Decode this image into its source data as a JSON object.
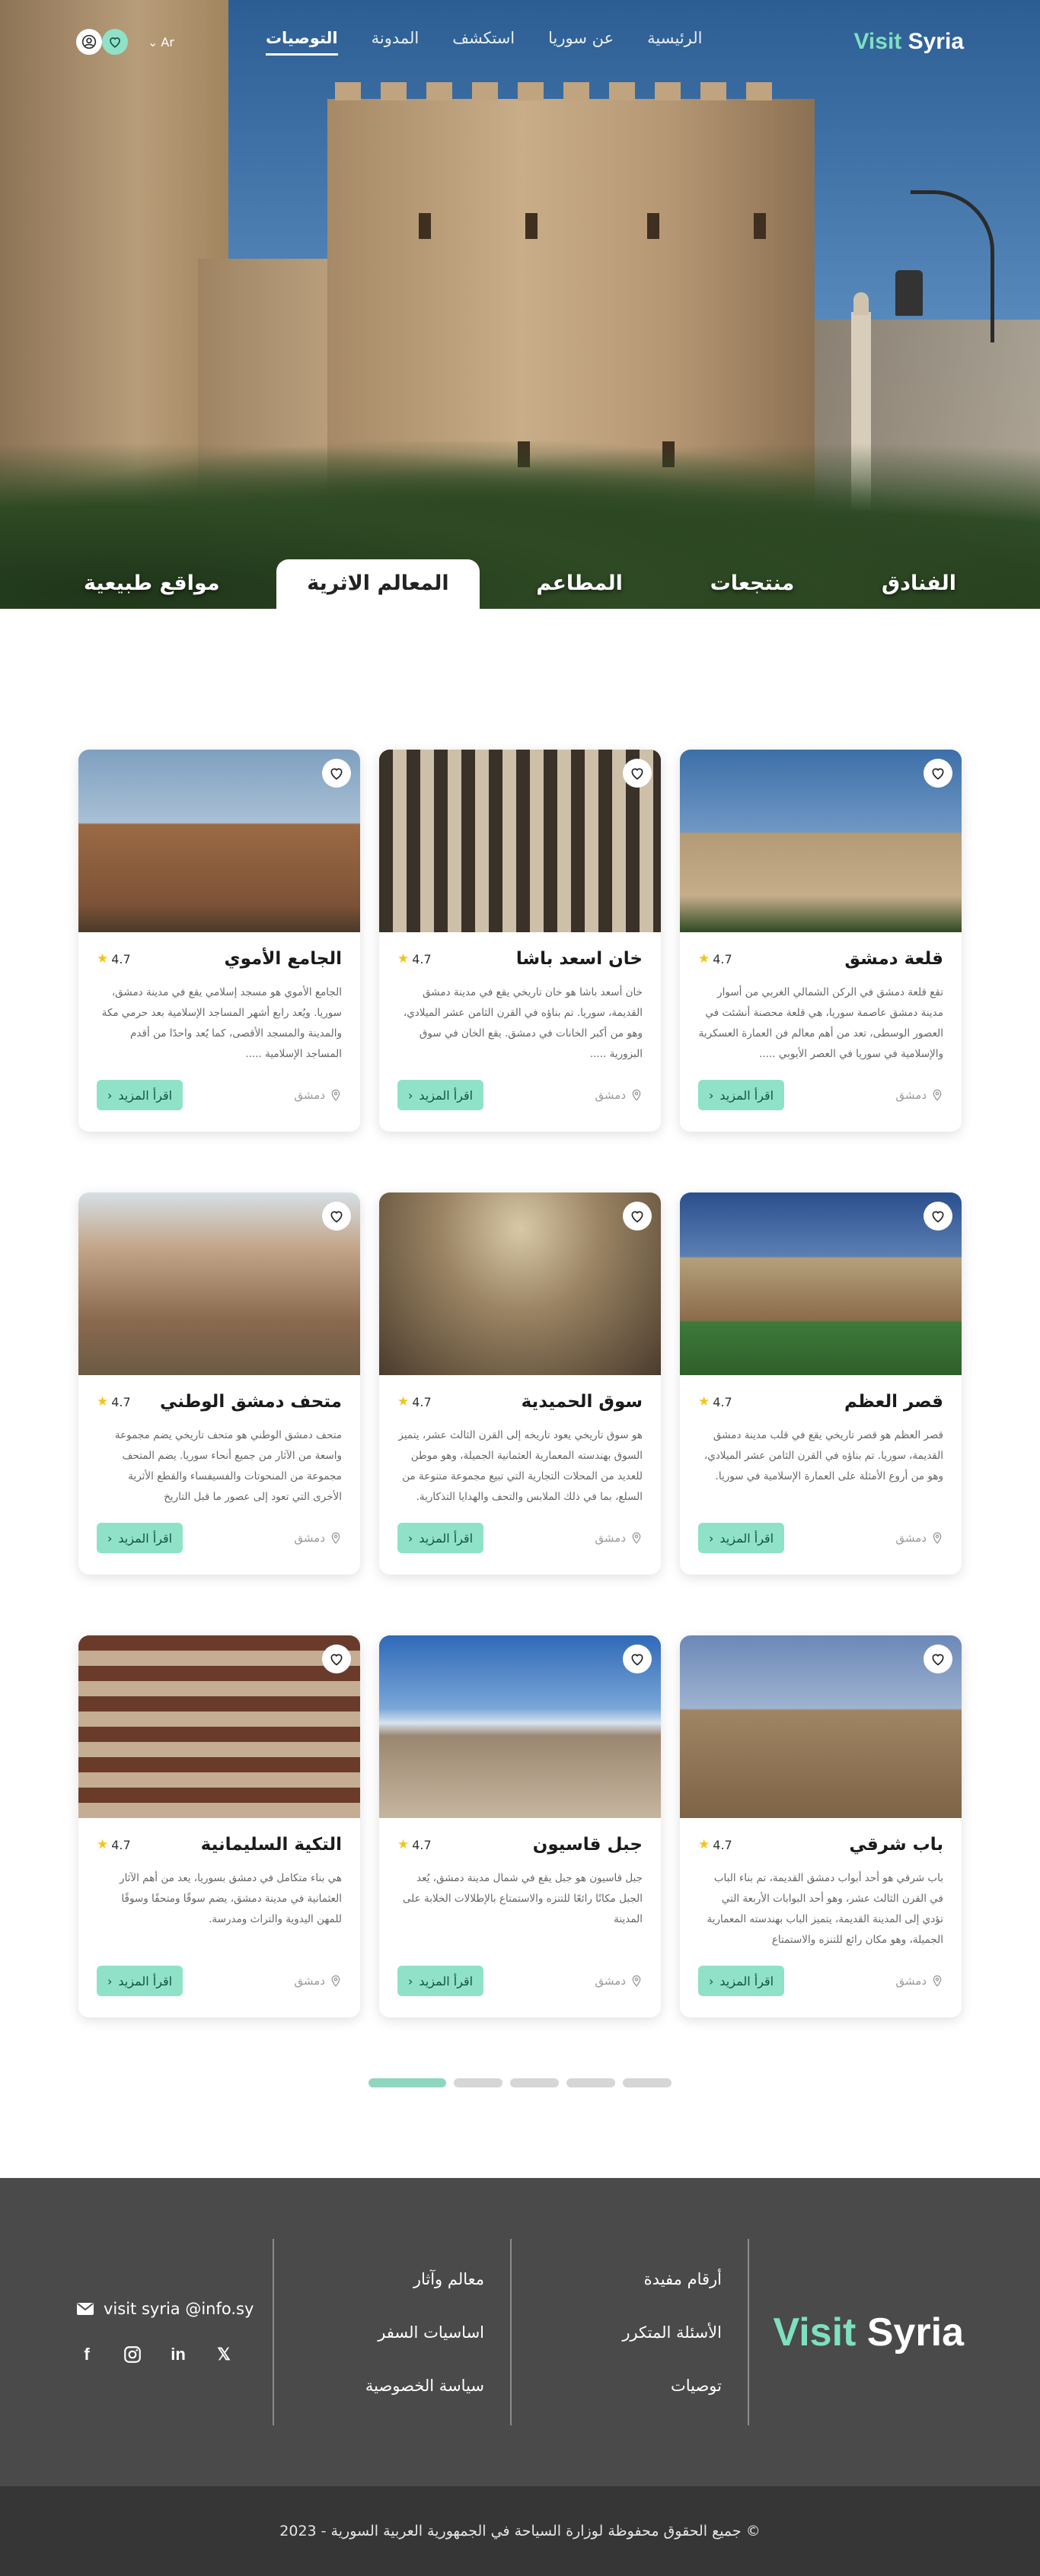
{
  "colors": {
    "accent": "#8fe2c7",
    "accent_dark": "#14523f",
    "footer_bg": "#4a4a4a",
    "copyright_bg": "#363636",
    "star": "#f2c417"
  },
  "nav": {
    "logo_part1": "Visit",
    "logo_part2": "Syria",
    "links": [
      "الرئيسية",
      "عن سوريا",
      "استكشف",
      "المدونة",
      "التوصيات"
    ],
    "active_link": "التوصيات",
    "lang": "Ar"
  },
  "hero_tabs": [
    "الفنادق",
    "منتجعات",
    "المطاعم",
    "المعالم الاثرية",
    "مواقع طبيعية"
  ],
  "active_hero_tab": "المعالم الاثرية",
  "cards": [
    {
      "title": "قلعة دمشق",
      "rating": "4.7",
      "desc": "تقع قلعة دمشق في الركن الشمالي الغربي من أسوار مدينة دمشق عاصمة سوريا، هي قلعة محصنة أنشئت في العصور الوسطى، تعد من أهم معالم فن العمارة العسكرية والإسلامية في سوريا في العصر الأيوبي .....",
      "location": "دمشق",
      "button": "اقرأ المزيد",
      "image": "citadel"
    },
    {
      "title": "خان اسعد باشا",
      "rating": "4.7",
      "desc": "خان أسعد باشا هو خان تاريخي يقع في مدينة دمشق القديمة، سوريا. تم بناؤه في القرن الثامن عشر الميلادي، وهو من أكبر الخانات في دمشق. يقع الخان في سوق البزورية .....",
      "location": "دمشق",
      "button": "اقرأ المزيد",
      "image": "khan"
    },
    {
      "title": "الجامع الأموي",
      "rating": "4.7",
      "desc": "الجامع الأموي هو مسجد إسلامي يقع في مدينة دمشق، سوريا. ويُعد رابع أشهر المساجد الإسلامية بعد حرمي مكة والمدينة والمسجد الأقصى، كما يُعد واحدًا من أقدم المساجد الإسلامية .....",
      "location": "دمشق",
      "button": "اقرأ المزيد",
      "image": "mosque"
    },
    {
      "title": "قصر العظم",
      "rating": "4.7",
      "desc": "قصر العظم هو قصر تاريخي يقع في قلب مدينة دمشق القديمة، سوريا. تم بناؤه في القرن الثامن عشر الميلادي، وهو من أروع الأمثلة على العمارة الإسلامية في سوريا.",
      "location": "دمشق",
      "button": "اقرأ المزيد",
      "image": "azm"
    },
    {
      "title": "سوق الحميدية",
      "rating": "4.7",
      "desc": "هو سوق تاريخي يعود تاريخه إلى القرن الثالث عشر، يتميز السوق بهندسته المعمارية العثمانية الجميلة، وهو موطن للعديد من المحلات التجارية التي تبيع مجموعة متنوعة من السلع، بما في ذلك الملابس والتحف والهدايا التذكارية.",
      "location": "دمشق",
      "button": "اقرأ المزيد",
      "image": "souq"
    },
    {
      "title": "متحف دمشق الوطني",
      "rating": "4.7",
      "desc": "متحف دمشق الوطني هو متحف تاريخي يضم مجموعة واسعة من الآثار من جميع أنحاء سوريا. يضم المتحف مجموعة من المنحوتات والفسيفساء والقطع الأثرية الأخرى التي تعود إلى عصور ما قبل التاريخ",
      "location": "دمشق",
      "button": "اقرأ المزيد",
      "image": "museum"
    },
    {
      "title": "باب شرقي",
      "rating": "4.7",
      "desc": "باب شرقي هو أحد أبواب دمشق القديمة، تم بناء الباب في القرن الثالث عشر، وهو أحد البوابات الأربعة التي تؤدي إلى المدينة القديمة، يتميز الباب بهندسته المعمارية الجميلة، وهو مكان رائع للتنزه والاستمتاع",
      "location": "دمشق",
      "button": "اقرأ المزيد",
      "image": "gate"
    },
    {
      "title": "جبل قاسيون",
      "rating": "4.7",
      "desc": "جبل قاسيون هو جبل يقع في شمال مدينة دمشق، يُعد الجبل مكانًا رائعًا للتنزه والاستمتاع بالإطلالات الخلابة على المدينة",
      "location": "دمشق",
      "button": "اقرأ المزيد",
      "image": "qasioun"
    },
    {
      "title": "التكية السليمانية",
      "rating": "4.7",
      "desc": "هي بناء متكامل في دمشق بسوريا، يعد من أهم الآثار العثمانية في مدينة دمشق، يضم سوقًا ومتحفًا وسوقًا للمهن اليدوية والتراث ومدرسة.",
      "location": "دمشق",
      "button": "اقرأ المزيد",
      "image": "takiyya"
    }
  ],
  "pager": {
    "pages": 5,
    "active": 1
  },
  "footer": {
    "logo_part1": "Visit",
    "logo_part2": "Syria",
    "col1": [
      "أرقام مفيدة",
      "الأسئلة المتكرر",
      "توصيات"
    ],
    "col2": [
      "معالم وآثار",
      "اساسيات السفر",
      "سياسة الخصوصية"
    ],
    "email": "visit syria @info.sy",
    "socials": [
      "x-icon",
      "linkedin-icon",
      "instagram-icon",
      "facebook-icon"
    ],
    "copyright": "جميع الحقوق محفوظة لوزارة السياحة في الجمهورية العربية السورية - 2023 ©"
  }
}
